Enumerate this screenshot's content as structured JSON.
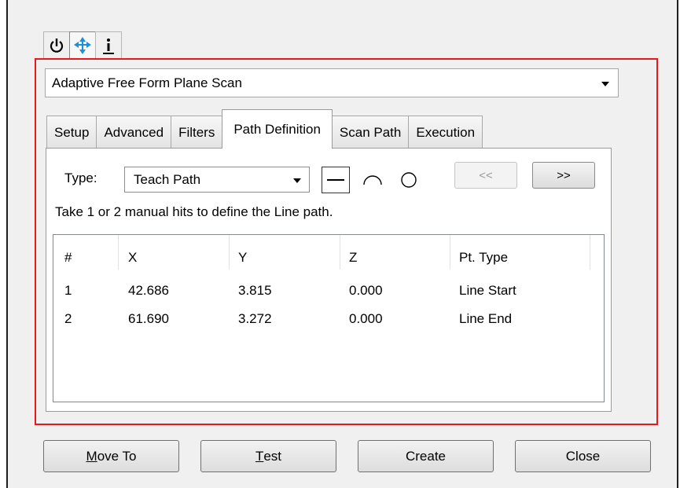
{
  "mode_select": {
    "value": "Adaptive Free Form Plane Scan"
  },
  "icon_tabs": [
    "power-icon",
    "axis-arrows-icon",
    "info-icon"
  ],
  "tabs": [
    {
      "label": "Setup"
    },
    {
      "label": "Advanced"
    },
    {
      "label": "Filters"
    },
    {
      "label": "Path Definition",
      "active": true
    },
    {
      "label": "Scan Path"
    },
    {
      "label": "Execution"
    }
  ],
  "path_definition": {
    "type_label": "Type:",
    "type_value": "Teach Path",
    "shapes": [
      "line-shape-icon",
      "arc-shape-icon",
      "circle-shape-icon"
    ],
    "prev_label": "<<",
    "next_label": ">>",
    "hint": "Take 1 or 2 manual hits to define the Line path."
  },
  "table": {
    "columns": [
      "#",
      "X",
      "Y",
      "Z",
      "Pt. Type"
    ],
    "rows": [
      [
        "1",
        "42.686",
        "3.815",
        "0.000",
        "Line Start"
      ],
      [
        "2",
        "61.690",
        "3.272",
        "0.000",
        "Line End"
      ]
    ]
  },
  "buttons": {
    "move_to_mnemonic": "M",
    "move_to_rest": "ove To",
    "test_mnemonic": "T",
    "test_rest": "est",
    "create": "Create",
    "close": "Close"
  },
  "colors": {
    "highlight_outline": "#e8191c",
    "accent_icon": "#1e90d8"
  }
}
